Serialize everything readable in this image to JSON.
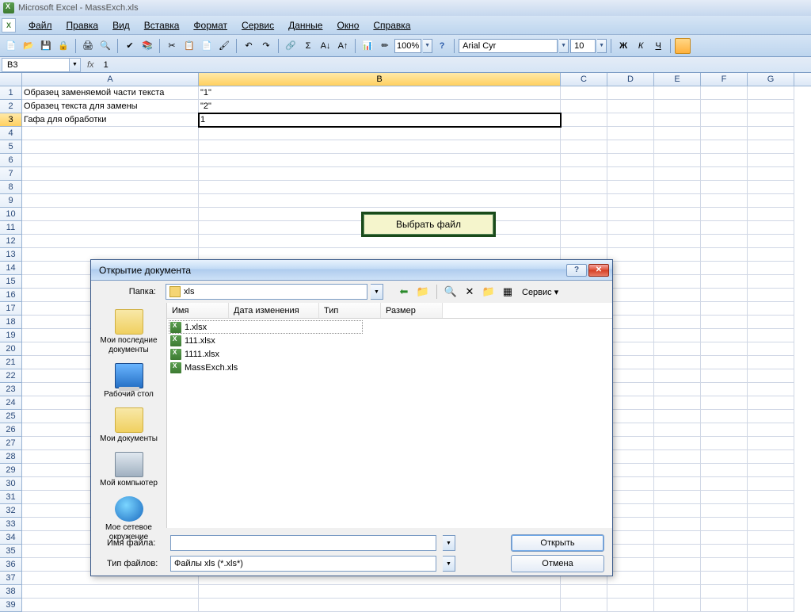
{
  "app": {
    "title": "Microsoft Excel - MassExch.xls"
  },
  "menu": {
    "items": [
      "Файл",
      "Правка",
      "Вид",
      "Вставка",
      "Формат",
      "Сервис",
      "Данные",
      "Окно",
      "Справка"
    ]
  },
  "toolbar": {
    "zoom": "100%",
    "font": "Arial Cyr",
    "size": "10"
  },
  "formula": {
    "name": "B3",
    "fx": "fx",
    "value": "1"
  },
  "columns": [
    "A",
    "B",
    "C",
    "D",
    "E",
    "F",
    "G"
  ],
  "cells": {
    "A1": "Образец заменяемой части текста",
    "B1": "\"1\"",
    "A2": "Образец текста для замены",
    "B2": "\"2\"",
    "A3": "Гафа для обработки",
    "B3": "1"
  },
  "button": {
    "label": "Выбрать файл"
  },
  "dialog": {
    "title": "Открытие документа",
    "folder_label": "Папка:",
    "folder_value": "xls",
    "tools_label": "Сервис",
    "sidebar": [
      "Мои последние документы",
      "Рабочий стол",
      "Мои документы",
      "Мой компьютер",
      "Мое сетевое окружение"
    ],
    "list_headers": [
      "Имя",
      "Дата изменения",
      "Тип",
      "Размер"
    ],
    "files": [
      "1.xlsx",
      "111.xlsx",
      "1111.xlsx",
      "MassExch.xls"
    ],
    "filename_label": "Имя файла:",
    "filename_value": "",
    "filetype_label": "Тип файлов:",
    "filetype_value": "Файлы xls (*.xls*)",
    "open": "Открыть",
    "cancel": "Отмена"
  }
}
